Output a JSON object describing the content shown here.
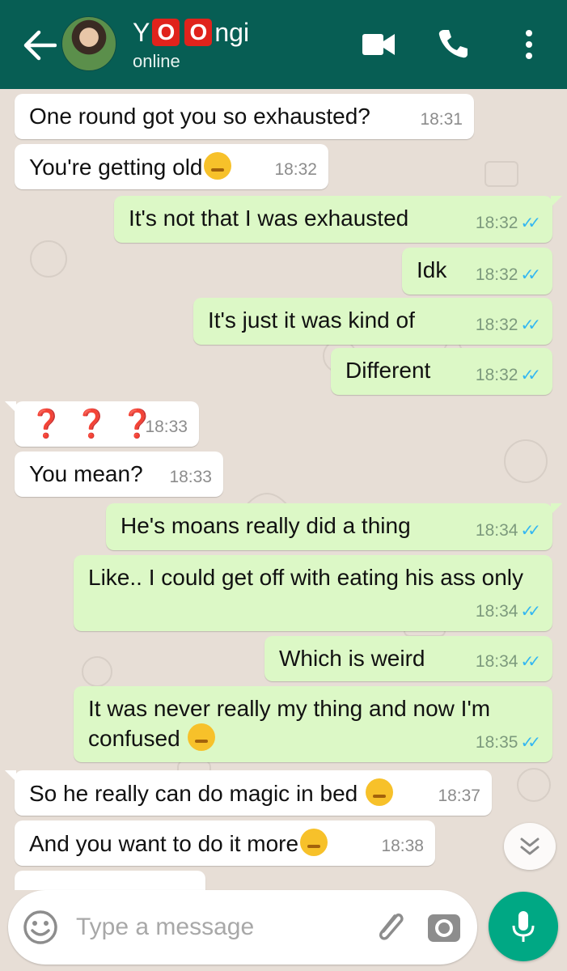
{
  "header": {
    "name_prefix": "Y",
    "name_o1": "O",
    "name_o2": "O",
    "name_suffix": "ngi",
    "status": "online"
  },
  "messages": [
    {
      "dir": "in",
      "text": "One round got you so exhausted?",
      "time": "18:31"
    },
    {
      "dir": "in",
      "text": "You're getting old",
      "emoji": "older-person-emoji",
      "time": "18:32"
    },
    {
      "dir": "out",
      "text": "It's not that I was exhausted",
      "time": "18:32",
      "status": "read"
    },
    {
      "dir": "out",
      "text": "Idk",
      "time": "18:32",
      "status": "read"
    },
    {
      "dir": "out",
      "text": "It's just it was kind of",
      "time": "18:32",
      "status": "read"
    },
    {
      "dir": "out",
      "text": "Different",
      "time": "18:32",
      "status": "read"
    },
    {
      "dir": "in",
      "text": "❓❓❓",
      "time": "18:33"
    },
    {
      "dir": "in",
      "text": "You mean?",
      "time": "18:33"
    },
    {
      "dir": "out",
      "text": "He's moans really did a thing",
      "time": "18:34",
      "status": "read"
    },
    {
      "dir": "out",
      "text": "Like.. I could get off with eating his ass only",
      "time": "18:34",
      "status": "read"
    },
    {
      "dir": "out",
      "text": "Which is weird",
      "time": "18:34",
      "status": "read"
    },
    {
      "dir": "out",
      "text": "It was never really my thing and now I'm confused",
      "emoji": "thinking-face-emoji",
      "time": "18:35",
      "status": "read"
    },
    {
      "dir": "in",
      "text": "So he really can do magic in bed",
      "emoji": "smirking-face-emoji",
      "time": "18:37"
    },
    {
      "dir": "in",
      "text": "And you want to do it more",
      "emoji": "smirking-face-emoji",
      "time": "18:38"
    }
  ],
  "composer": {
    "placeholder": "Type a message"
  },
  "colors": {
    "header": "#075e54",
    "outgoing_bubble": "#dcf8c6",
    "incoming_bubble": "#ffffff",
    "read_ticks": "#34b7f1",
    "mic_button": "#00a884",
    "chat_background": "#e7ded6"
  }
}
